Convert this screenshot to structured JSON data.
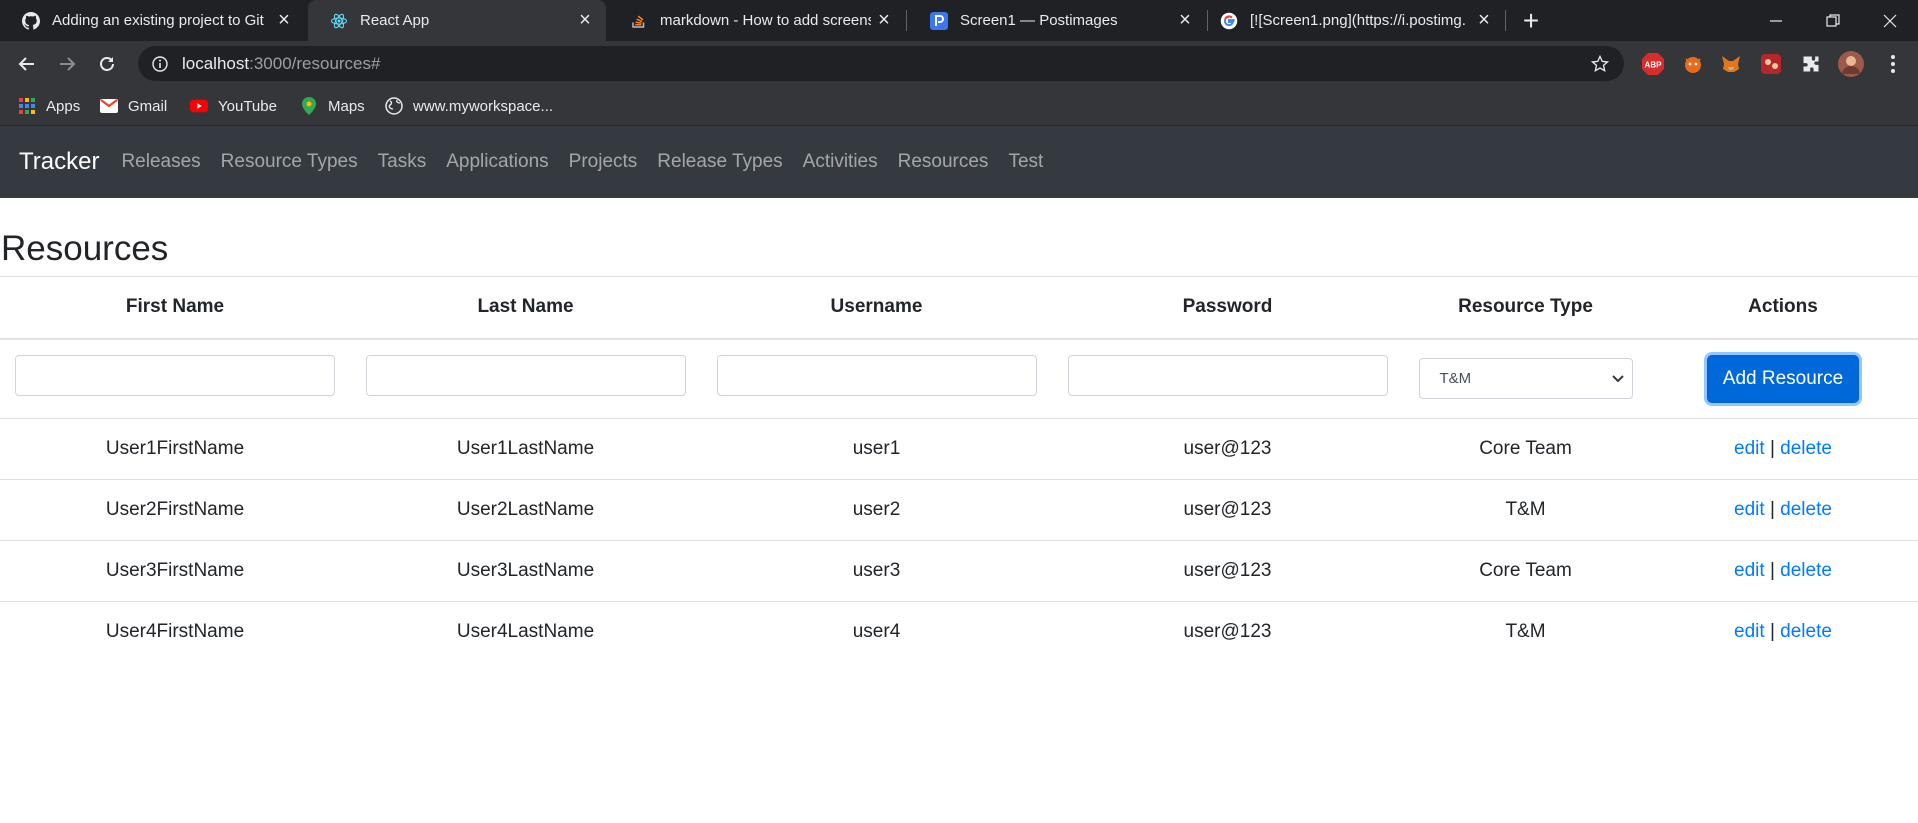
{
  "browser": {
    "tabs": [
      {
        "title": "Adding an existing project to Git",
        "icon": "github-icon"
      },
      {
        "title": "React App",
        "icon": "react-icon",
        "active": true
      },
      {
        "title": "markdown - How to add screens",
        "icon": "stackoverflow-icon"
      },
      {
        "title": "Screen1 — Postimages",
        "icon": "postimages-icon"
      },
      {
        "title": "[![Screen1.png](https://i.postimg.",
        "icon": "google-icon"
      }
    ],
    "url_host": "localhost",
    "url_path": ":3000/resources#",
    "bookmarks": [
      {
        "label": "Apps",
        "icon": "apps-grid-icon"
      },
      {
        "label": "Gmail",
        "icon": "gmail-icon"
      },
      {
        "label": "YouTube",
        "icon": "youtube-icon"
      },
      {
        "label": "Maps",
        "icon": "maps-icon"
      },
      {
        "label": "www.myworkspace...",
        "icon": "globe-icon"
      }
    ],
    "extensions": [
      "ABP"
    ]
  },
  "nav": {
    "brand": "Tracker",
    "links": [
      "Releases",
      "Resource Types",
      "Tasks",
      "Applications",
      "Projects",
      "Release Types",
      "Activities",
      "Resources",
      "Test"
    ]
  },
  "page": {
    "title": "Resources"
  },
  "table": {
    "headers": [
      "First Name",
      "Last Name",
      "Username",
      "Password",
      "Resource Type",
      "Actions"
    ],
    "form": {
      "resource_type_selected": "T&M",
      "add_button": "Add Resource"
    },
    "rows": [
      {
        "first": "User1FirstName",
        "last": "User1LastName",
        "username": "user1",
        "password": "user@123",
        "type": "Core Team"
      },
      {
        "first": "User2FirstName",
        "last": "User2LastName",
        "username": "user2",
        "password": "user@123",
        "type": "T&M"
      },
      {
        "first": "User3FirstName",
        "last": "User3LastName",
        "username": "user3",
        "password": "user@123",
        "type": "Core Team"
      },
      {
        "first": "User4FirstName",
        "last": "User4LastName",
        "username": "user4",
        "password": "user@123",
        "type": "T&M"
      }
    ],
    "edit_label": "edit",
    "delete_label": "delete",
    "separator": "|"
  }
}
